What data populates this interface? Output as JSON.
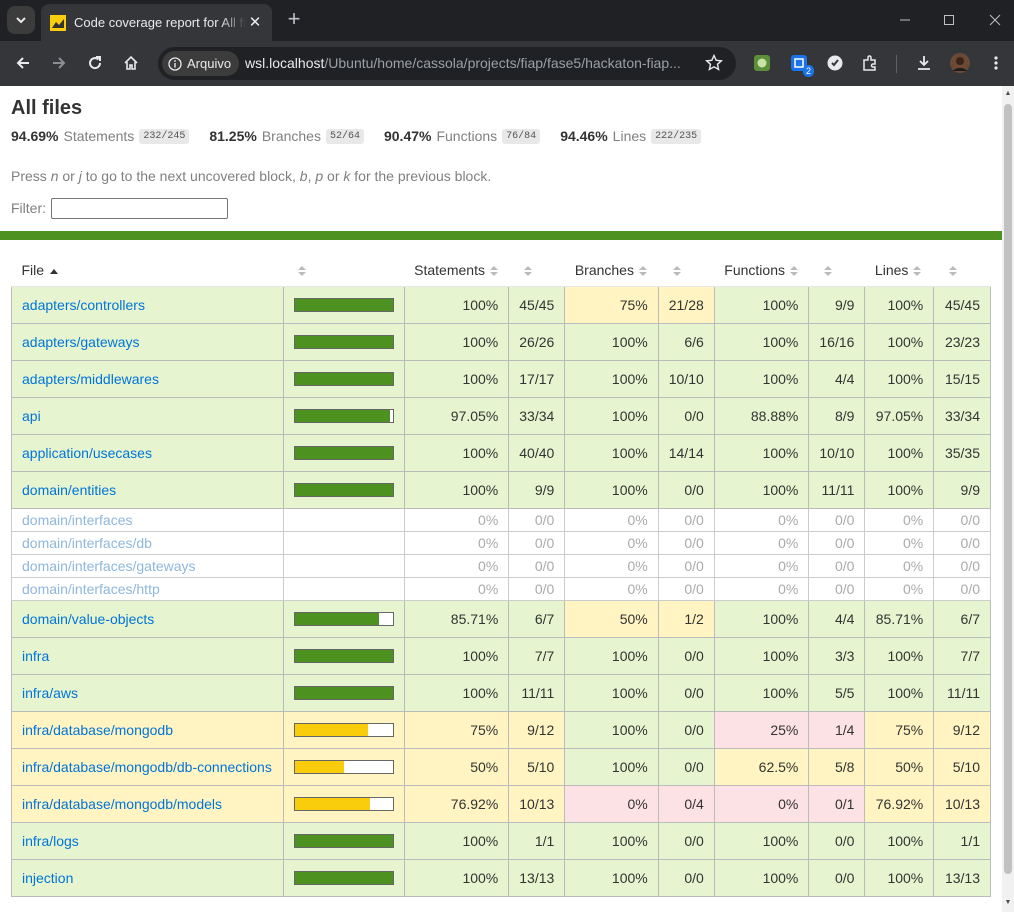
{
  "browser": {
    "tab_title": "Code coverage report for All files",
    "site_chip_label": "Arquivo",
    "url_host": "wsl.localhost",
    "url_path": "/Ubuntu/home/cassola/projects/fiap/fase5/hackaton-fiap...",
    "extension_badge": "2"
  },
  "report": {
    "title": "All files",
    "summary": [
      {
        "pct": "94.69%",
        "label": "Statements",
        "fraction": "232/245"
      },
      {
        "pct": "81.25%",
        "label": "Branches",
        "fraction": "52/64"
      },
      {
        "pct": "90.47%",
        "label": "Functions",
        "fraction": "76/84"
      },
      {
        "pct": "94.46%",
        "label": "Lines",
        "fraction": "222/235"
      }
    ],
    "hint": {
      "press": "Press",
      "n": "n",
      "or1": "or",
      "j": "j",
      "mid": "to go to the next uncovered block,",
      "b": "b",
      "comma": ",",
      "p": "p",
      "or2": "or",
      "k": "k",
      "end": "for the previous block."
    },
    "filter_label": "Filter:",
    "filter_value": "",
    "headers": {
      "file": "File",
      "statements": "Statements",
      "branches": "Branches",
      "functions": "Functions",
      "lines": "Lines"
    },
    "rows": [
      {
        "file": "adapters/controllers",
        "coverage": 100,
        "level": "high",
        "stmt_pct": "100%",
        "stmt_abs": "45/45",
        "branch_pct": "75%",
        "branch_abs": "21/28",
        "branch_level": "medium",
        "func_pct": "100%",
        "func_abs": "9/9",
        "func_level": "high",
        "line_pct": "100%",
        "line_abs": "45/45",
        "line_level": "high",
        "empty": false
      },
      {
        "file": "adapters/gateways",
        "coverage": 100,
        "level": "high",
        "stmt_pct": "100%",
        "stmt_abs": "26/26",
        "branch_pct": "100%",
        "branch_abs": "6/6",
        "branch_level": "high",
        "func_pct": "100%",
        "func_abs": "16/16",
        "func_level": "high",
        "line_pct": "100%",
        "line_abs": "23/23",
        "line_level": "high",
        "empty": false
      },
      {
        "file": "adapters/middlewares",
        "coverage": 100,
        "level": "high",
        "stmt_pct": "100%",
        "stmt_abs": "17/17",
        "branch_pct": "100%",
        "branch_abs": "10/10",
        "branch_level": "high",
        "func_pct": "100%",
        "func_abs": "4/4",
        "func_level": "high",
        "line_pct": "100%",
        "line_abs": "15/15",
        "line_level": "high",
        "empty": false
      },
      {
        "file": "api",
        "coverage": 97.05,
        "level": "high",
        "stmt_pct": "97.05%",
        "stmt_abs": "33/34",
        "branch_pct": "100%",
        "branch_abs": "0/0",
        "branch_level": "high",
        "func_pct": "88.88%",
        "func_abs": "8/9",
        "func_level": "high",
        "line_pct": "97.05%",
        "line_abs": "33/34",
        "line_level": "high",
        "empty": false
      },
      {
        "file": "application/usecases",
        "coverage": 100,
        "level": "high",
        "stmt_pct": "100%",
        "stmt_abs": "40/40",
        "branch_pct": "100%",
        "branch_abs": "14/14",
        "branch_level": "high",
        "func_pct": "100%",
        "func_abs": "10/10",
        "func_level": "high",
        "line_pct": "100%",
        "line_abs": "35/35",
        "line_level": "high",
        "empty": false
      },
      {
        "file": "domain/entities",
        "coverage": 100,
        "level": "high",
        "stmt_pct": "100%",
        "stmt_abs": "9/9",
        "branch_pct": "100%",
        "branch_abs": "0/0",
        "branch_level": "high",
        "func_pct": "100%",
        "func_abs": "11/11",
        "func_level": "high",
        "line_pct": "100%",
        "line_abs": "9/9",
        "line_level": "high",
        "empty": false
      },
      {
        "file": "domain/interfaces",
        "coverage": 0,
        "level": "empty",
        "stmt_pct": "0%",
        "stmt_abs": "0/0",
        "branch_pct": "0%",
        "branch_abs": "0/0",
        "branch_level": "empty",
        "func_pct": "0%",
        "func_abs": "0/0",
        "func_level": "empty",
        "line_pct": "0%",
        "line_abs": "0/0",
        "line_level": "empty",
        "empty": true
      },
      {
        "file": "domain/interfaces/db",
        "coverage": 0,
        "level": "empty",
        "stmt_pct": "0%",
        "stmt_abs": "0/0",
        "branch_pct": "0%",
        "branch_abs": "0/0",
        "branch_level": "empty",
        "func_pct": "0%",
        "func_abs": "0/0",
        "func_level": "empty",
        "line_pct": "0%",
        "line_abs": "0/0",
        "line_level": "empty",
        "empty": true
      },
      {
        "file": "domain/interfaces/gateways",
        "coverage": 0,
        "level": "empty",
        "stmt_pct": "0%",
        "stmt_abs": "0/0",
        "branch_pct": "0%",
        "branch_abs": "0/0",
        "branch_level": "empty",
        "func_pct": "0%",
        "func_abs": "0/0",
        "func_level": "empty",
        "line_pct": "0%",
        "line_abs": "0/0",
        "line_level": "empty",
        "empty": true
      },
      {
        "file": "domain/interfaces/http",
        "coverage": 0,
        "level": "empty",
        "stmt_pct": "0%",
        "stmt_abs": "0/0",
        "branch_pct": "0%",
        "branch_abs": "0/0",
        "branch_level": "empty",
        "func_pct": "0%",
        "func_abs": "0/0",
        "func_level": "empty",
        "line_pct": "0%",
        "line_abs": "0/0",
        "line_level": "empty",
        "empty": true
      },
      {
        "file": "domain/value-objects",
        "coverage": 85.71,
        "level": "high",
        "stmt_pct": "85.71%",
        "stmt_abs": "6/7",
        "branch_pct": "50%",
        "branch_abs": "1/2",
        "branch_level": "medium",
        "func_pct": "100%",
        "func_abs": "4/4",
        "func_level": "high",
        "line_pct": "85.71%",
        "line_abs": "6/7",
        "line_level": "high",
        "empty": false
      },
      {
        "file": "infra",
        "coverage": 100,
        "level": "high",
        "stmt_pct": "100%",
        "stmt_abs": "7/7",
        "branch_pct": "100%",
        "branch_abs": "0/0",
        "branch_level": "high",
        "func_pct": "100%",
        "func_abs": "3/3",
        "func_level": "high",
        "line_pct": "100%",
        "line_abs": "7/7",
        "line_level": "high",
        "empty": false
      },
      {
        "file": "infra/aws",
        "coverage": 100,
        "level": "high",
        "stmt_pct": "100%",
        "stmt_abs": "11/11",
        "branch_pct": "100%",
        "branch_abs": "0/0",
        "branch_level": "high",
        "func_pct": "100%",
        "func_abs": "5/5",
        "func_level": "high",
        "line_pct": "100%",
        "line_abs": "11/11",
        "line_level": "high",
        "empty": false
      },
      {
        "file": "infra/database/mongodb",
        "coverage": 75,
        "level": "medium",
        "stmt_pct": "75%",
        "stmt_abs": "9/12",
        "branch_pct": "100%",
        "branch_abs": "0/0",
        "branch_level": "high",
        "func_pct": "25%",
        "func_abs": "1/4",
        "func_level": "low",
        "line_pct": "75%",
        "line_abs": "9/12",
        "line_level": "medium",
        "empty": false
      },
      {
        "file": "infra/database/mongodb/db-connections",
        "coverage": 50,
        "level": "medium",
        "stmt_pct": "50%",
        "stmt_abs": "5/10",
        "branch_pct": "100%",
        "branch_abs": "0/0",
        "branch_level": "high",
        "func_pct": "62.5%",
        "func_abs": "5/8",
        "func_level": "medium",
        "line_pct": "50%",
        "line_abs": "5/10",
        "line_level": "medium",
        "empty": false
      },
      {
        "file": "infra/database/mongodb/models",
        "coverage": 76.92,
        "level": "medium",
        "stmt_pct": "76.92%",
        "stmt_abs": "10/13",
        "branch_pct": "0%",
        "branch_abs": "0/4",
        "branch_level": "low",
        "func_pct": "0%",
        "func_abs": "0/1",
        "func_level": "low",
        "line_pct": "76.92%",
        "line_abs": "10/13",
        "line_level": "medium",
        "empty": false
      },
      {
        "file": "infra/logs",
        "coverage": 100,
        "level": "high",
        "stmt_pct": "100%",
        "stmt_abs": "1/1",
        "branch_pct": "100%",
        "branch_abs": "0/0",
        "branch_level": "high",
        "func_pct": "100%",
        "func_abs": "0/0",
        "func_level": "high",
        "line_pct": "100%",
        "line_abs": "1/1",
        "line_level": "high",
        "empty": false
      },
      {
        "file": "injection",
        "coverage": 100,
        "level": "high",
        "stmt_pct": "100%",
        "stmt_abs": "13/13",
        "branch_pct": "100%",
        "branch_abs": "0/0",
        "branch_level": "high",
        "func_pct": "100%",
        "func_abs": "0/0",
        "func_level": "high",
        "line_pct": "100%",
        "line_abs": "13/13",
        "line_level": "high",
        "empty": false
      }
    ]
  },
  "colors": {
    "high_bg": "#e6f5d0",
    "medium_bg": "#fff4c2",
    "low_bg": "#fce1e5",
    "high_fill": "#4d9221",
    "medium_fill": "#f9cd0b",
    "link": "#0074d9"
  },
  "icons": [
    "chevron-down-icon",
    "close-icon",
    "plus-icon",
    "minimize-icon",
    "maximize-icon",
    "back-icon",
    "forward-icon",
    "reload-icon",
    "home-icon",
    "info-icon",
    "star-icon",
    "extensions-icon",
    "download-icon",
    "menu-icon",
    "sort-asc-icon",
    "sorter-icon"
  ]
}
